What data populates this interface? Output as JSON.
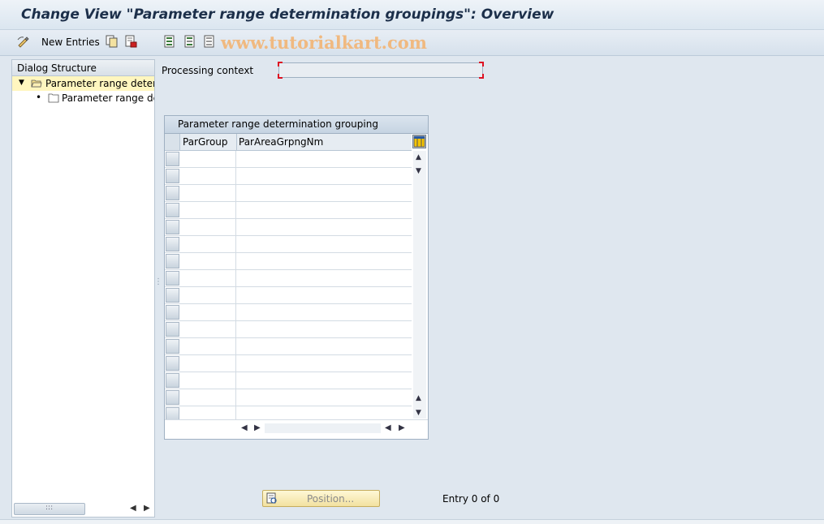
{
  "window": {
    "title": "Change View \"Parameter range determination groupings\": Overview"
  },
  "toolbar": {
    "new_entries_label": "New Entries",
    "watermark": "www.tutorialkart.com"
  },
  "dialog_structure": {
    "header": "Dialog Structure",
    "items": [
      {
        "label": "Parameter range determination groupings",
        "expanded": true,
        "selected": true
      },
      {
        "label": "Parameter range determination",
        "expanded": false,
        "selected": false
      }
    ]
  },
  "form": {
    "processing_context_label": "Processing context",
    "processing_context_value": ""
  },
  "table": {
    "title": "Parameter range determination grouping",
    "columns": [
      "ParGroup",
      "ParAreaGrpngNm"
    ],
    "rows": [
      [
        "",
        ""
      ],
      [
        "",
        ""
      ],
      [
        "",
        ""
      ],
      [
        "",
        ""
      ],
      [
        "",
        ""
      ],
      [
        "",
        ""
      ],
      [
        "",
        ""
      ],
      [
        "",
        ""
      ],
      [
        "",
        ""
      ],
      [
        "",
        ""
      ],
      [
        "",
        ""
      ],
      [
        "",
        ""
      ],
      [
        "",
        ""
      ],
      [
        "",
        ""
      ],
      [
        "",
        ""
      ],
      [
        "",
        ""
      ]
    ]
  },
  "footer": {
    "position_button_label": "Position...",
    "entry_info": "Entry 0 of 0"
  },
  "colors": {
    "title_text": "#1c2f4a",
    "background": "#dfe7ef",
    "selected_tree_row": "#fff6bf",
    "required_marker": "#dd1122"
  }
}
